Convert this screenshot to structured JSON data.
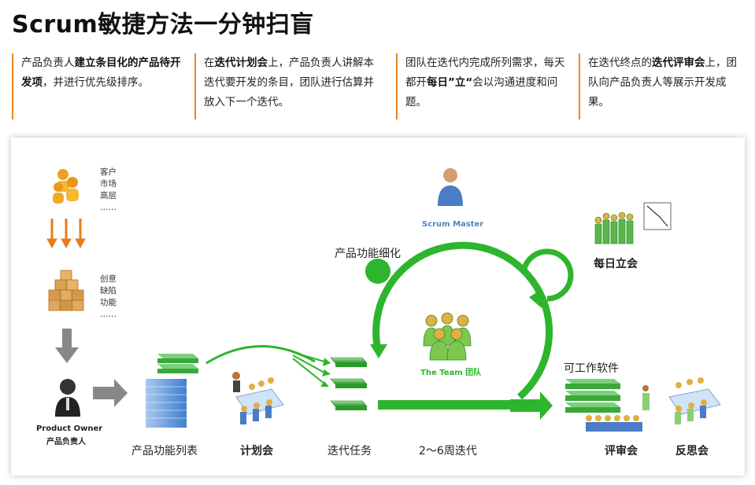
{
  "title": "Scrum敏捷方法一分钟扫盲",
  "steps": [
    {
      "t1": "产品负责人",
      "b1": "建立条目化的产品待开发项",
      "t2": "，并进行优先级排序。"
    },
    {
      "t1": "在",
      "b1": "迭代计划会",
      "t2": "上，产品负责人讲解本迭代要开发的条目，团队进行估算并放入下一个迭代。"
    },
    {
      "t1": "团队在迭代内完成所列需求，每天都开",
      "b1": "每日”立“",
      "t2": "会以沟通进度和问题。"
    },
    {
      "t1": "在迭代终点的",
      "b1": "迭代评审会",
      "t2": "上，团队向产品负责人等展示开发成果。"
    }
  ],
  "sources": {
    "l1": "客户",
    "l2": "市场",
    "l3": "高层",
    "l4": "……"
  },
  "needs": {
    "l1": "创意",
    "l2": "缺陷",
    "l3": "功能",
    "l4": "……"
  },
  "product_owner": {
    "en": "Product Owner",
    "cn": "产品负责人"
  },
  "scrum_master": "Scrum Master",
  "team": "The Team 团队",
  "labels": {
    "backlog": "产品功能列表",
    "planning": "计划会",
    "sprint_tasks": "迭代任务",
    "sprint_length": "2～6周迭代",
    "refinement": "产品功能细化",
    "daily": "每日立会",
    "working_software": "可工作软件",
    "review": "评审会",
    "retro": "反思会"
  },
  "colors": {
    "accent": "#f0821e",
    "green": "#2db52d",
    "title": "#111111"
  }
}
